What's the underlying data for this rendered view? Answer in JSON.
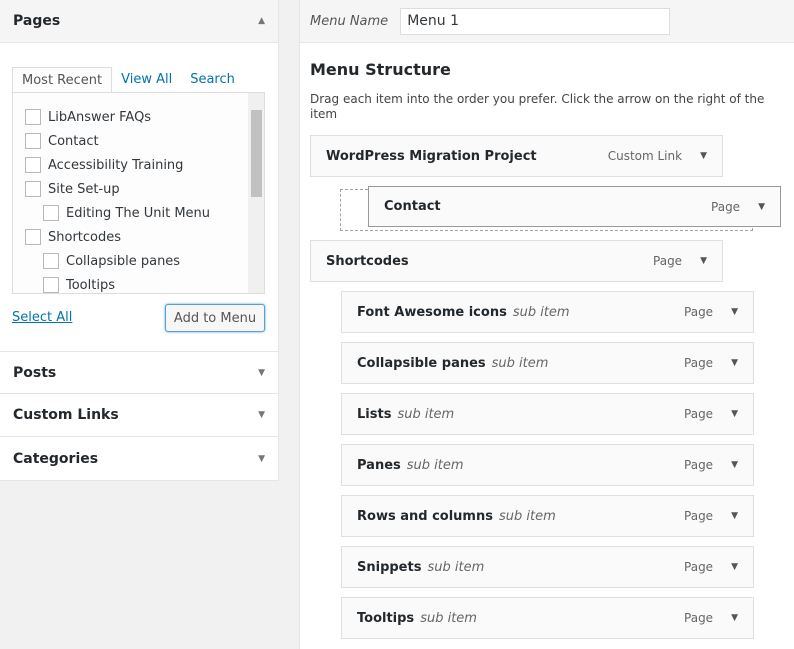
{
  "left": {
    "pages": {
      "title": "Pages",
      "tabs": [
        "Most Recent",
        "View All",
        "Search"
      ],
      "items": [
        {
          "label": "LibAnswer FAQs",
          "level": 0
        },
        {
          "label": "Contact",
          "level": 0
        },
        {
          "label": "Accessibility Training",
          "level": 0
        },
        {
          "label": "Site Set-up",
          "level": 0
        },
        {
          "label": "Editing The Unit Menu",
          "level": 1
        },
        {
          "label": "Shortcodes",
          "level": 0
        },
        {
          "label": "Collapsible panes",
          "level": 1
        },
        {
          "label": "Tooltips",
          "level": 1
        }
      ],
      "select_all": "Select All",
      "add_button": "Add to Menu"
    },
    "sections": [
      "Posts",
      "Custom Links",
      "Categories"
    ]
  },
  "menu": {
    "name_label": "Menu Name",
    "name_value": "Menu 1",
    "structure_title": "Menu Structure",
    "description": "Drag each item into the order you prefer. Click the arrow on the right of the item",
    "items": [
      {
        "title": "WordPress Migration Project",
        "type": "Custom Link",
        "sub": ""
      },
      {
        "title": "Contact",
        "type": "Page",
        "sub": ""
      },
      {
        "title": "Shortcodes",
        "type": "Page",
        "sub": ""
      },
      {
        "title": "Font Awesome icons",
        "type": "Page",
        "sub": "sub item"
      },
      {
        "title": "Collapsible panes",
        "type": "Page",
        "sub": "sub item"
      },
      {
        "title": "Lists",
        "type": "Page",
        "sub": "sub item"
      },
      {
        "title": "Panes",
        "type": "Page",
        "sub": "sub item"
      },
      {
        "title": "Rows and columns",
        "type": "Page",
        "sub": "sub item"
      },
      {
        "title": "Snippets",
        "type": "Page",
        "sub": "sub item"
      },
      {
        "title": "Tooltips",
        "type": "Page",
        "sub": "sub item"
      }
    ]
  }
}
